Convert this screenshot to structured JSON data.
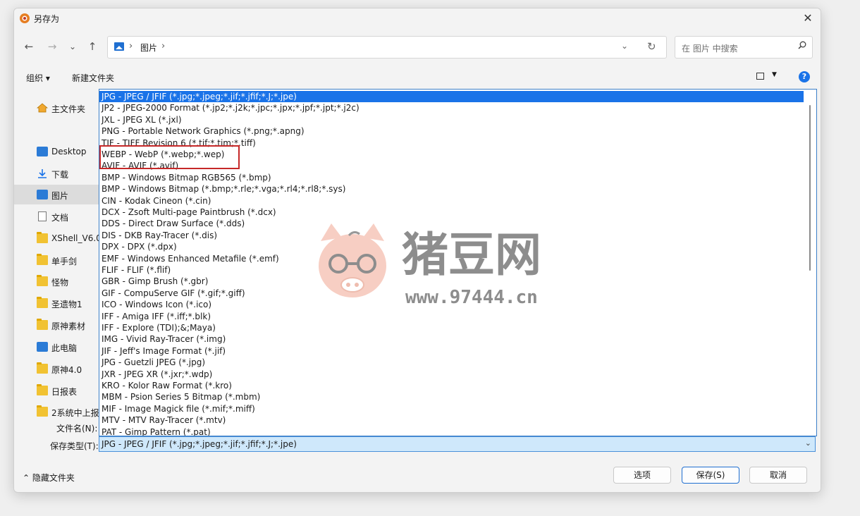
{
  "window": {
    "title": "另存为",
    "close_symbol": "✕"
  },
  "nav": {
    "back": "←",
    "forward": "→",
    "recent": "⌄",
    "up": "↑",
    "breadcrumb": [
      "图片"
    ],
    "search_placeholder": "在 图片 中搜索"
  },
  "toolbar": {
    "organize": "组织 ▾",
    "new_folder": "新建文件夹",
    "help": "?"
  },
  "sidebar": {
    "items": [
      {
        "label": "主文件夹",
        "icon": "home-icon"
      },
      {
        "label": "Desktop",
        "icon": "desktop-icon"
      },
      {
        "label": "下载",
        "icon": "download-icon"
      },
      {
        "label": "图片",
        "icon": "pictures-icon",
        "selected": true
      },
      {
        "label": "文档",
        "icon": "documents-icon"
      },
      {
        "label": "XShell_V6.0.",
        "icon": "folder-icon"
      },
      {
        "label": "单手剑",
        "icon": "folder-icon"
      },
      {
        "label": "怪物",
        "icon": "folder-icon"
      },
      {
        "label": "圣遗物1",
        "icon": "folder-icon"
      },
      {
        "label": "原神素材",
        "icon": "folder-icon"
      },
      {
        "label": "此电脑",
        "icon": "computer-icon"
      },
      {
        "label": "原神4.0",
        "icon": "folder-icon"
      },
      {
        "label": "日报表",
        "icon": "folder-icon"
      },
      {
        "label": "2系统中上报",
        "icon": "folder-icon"
      }
    ]
  },
  "file_types": [
    "JPG - JPEG / JFIF (*.jpg;*.jpeg;*.jif;*.jfif;*.J;*.jpe)",
    "JP2 - JPEG-2000 Format (*.jp2;*.j2k;*.jpc;*.jpx;*.jpf;*.jpt;*.j2c)",
    "JXL - JPEG XL (*.jxl)",
    "PNG - Portable Network Graphics (*.png;*.apng)",
    "TIF - TIFF Revision 6 (*.tif;*.tim;*.tiff)",
    "WEBP - WebP (*.webp;*.wep)",
    "AVIF - AVIF (*.avif)",
    "BMP - Windows Bitmap RGB565 (*.bmp)",
    "BMP - Windows Bitmap (*.bmp;*.rle;*.vga;*.rl4;*.rl8;*.sys)",
    "CIN - Kodak Cineon (*.cin)",
    "DCX - Zsoft Multi-page Paintbrush (*.dcx)",
    "DDS - Direct Draw Surface (*.dds)",
    "DIS - DKB Ray-Tracer (*.dis)",
    "DPX - DPX (*.dpx)",
    "EMF - Windows Enhanced Metafile (*.emf)",
    "FLIF - FLIF (*.flif)",
    "GBR - Gimp Brush (*.gbr)",
    "GIF - CompuServe GIF (*.gif;*.giff)",
    "ICO - Windows Icon (*.ico)",
    "IFF - Amiga IFF (*.iff;*.blk)",
    "IFF - Explore (TDI);&;Maya)",
    "IMG - Vivid Ray-Tracer (*.img)",
    "JIF - Jeff's Image Format (*.jif)",
    "JPG - Guetzli JPEG (*.jpg)",
    "JXR - JPEG XR (*.jxr;*.wdp)",
    "KRO - Kolor Raw Format (*.kro)",
    "MBM - Psion Series 5 Bitmap (*.mbm)",
    "MIF - Image Magick file (*.mif;*.miff)",
    "MTV - MTV Ray-Tracer (*.mtv)",
    "PAT - Gimp Pattern (*.pat)"
  ],
  "fields": {
    "filename_label": "文件名(N):",
    "filetype_label": "保存类型(T):",
    "filetype_value": "JPG - JPEG / JFIF (*.jpg;*.jpeg;*.jif;*.jfif;*.J;*.jpe)"
  },
  "footer": {
    "hide_folders": "隐藏文件夹",
    "options": "选项",
    "save": "保存(S)",
    "cancel": "取消"
  },
  "watermark": {
    "brand": "猪豆网",
    "url": "www.97444.cn"
  },
  "colors": {
    "accent": "#1a73e8",
    "highlight_border": "#c62828"
  }
}
